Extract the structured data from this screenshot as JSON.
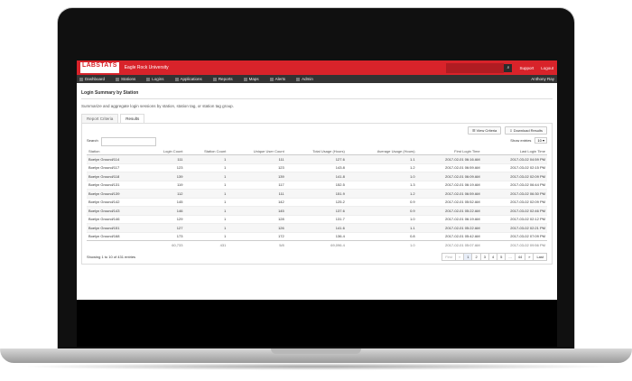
{
  "app": {
    "logo": "LABSTATS",
    "org": "Eagle Rock University",
    "top_links": [
      "Support",
      "Logout"
    ],
    "nav": [
      {
        "label": "Dashboard",
        "icon": "home-icon"
      },
      {
        "label": "Stations",
        "icon": "monitor-icon"
      },
      {
        "label": "Logins",
        "icon": "user-icon"
      },
      {
        "label": "Applications",
        "icon": "app-icon"
      },
      {
        "label": "Reports",
        "icon": "chart-icon"
      },
      {
        "label": "Maps",
        "icon": "map-icon"
      },
      {
        "label": "Alerts",
        "icon": "bell-icon"
      },
      {
        "label": "Admin",
        "icon": "gear-icon"
      }
    ],
    "user": "Anthony Ray"
  },
  "report": {
    "title": "Login Summary by Station",
    "description": "Summarize and aggregate login sessions by station, station tag, or station tag group.",
    "tabs": [
      "Report Criteria",
      "Results"
    ],
    "view_criteria": "View Criteria",
    "download": "Download Results",
    "search_label": "Search",
    "show_entries_label": "Show entries",
    "show_entries_value": "10",
    "columns": [
      "Station",
      "Login Count",
      "Station Count",
      "Unique User Count",
      "Total Usage (Hours)",
      "Average Usage (Hours)",
      "First Login Time",
      "Last Login Time"
    ],
    "rows": [
      [
        "Boelyn Ground/114",
        "111",
        "1",
        "111",
        "127.6",
        "1.1",
        "2017-02-01 06:16 AM",
        "2017-03-02 04:59 PM"
      ],
      [
        "Boelyn Ground/117",
        "123",
        "1",
        "123",
        "143.8",
        "1.2",
        "2017-02-01 06:59 AM",
        "2017-03-02 02:15 PM"
      ],
      [
        "Boelyn Ground/118",
        "139",
        "1",
        "139",
        "141.8",
        "1.0",
        "2017-02-01 06:09 AM",
        "2017-03-02 02:09 PM"
      ],
      [
        "Boelyn Ground/131",
        "119",
        "1",
        "117",
        "152.5",
        "1.3",
        "2017-02-01 06:19 AM",
        "2017-03-02 06:44 PM"
      ],
      [
        "Boelyn Ground/139",
        "112",
        "1",
        "111",
        "151.9",
        "1.2",
        "2017-02-01 06:59 AM",
        "2017-03-02 06:30 PM"
      ],
      [
        "Boelyn Ground/142",
        "145",
        "1",
        "142",
        "125.2",
        "0.9",
        "2017-02-01 05:52 AM",
        "2017-03-02 02:09 PM"
      ],
      [
        "Boelyn Ground/143",
        "146",
        "1",
        "145",
        "137.6",
        "0.9",
        "2017-02-01 05:22 AM",
        "2017-03-02 02:46 PM"
      ],
      [
        "Boelyn Ground/146",
        "129",
        "1",
        "128",
        "131.7",
        "1.0",
        "2017-02-01 06:19 AM",
        "2017-03-02 02:12 PM"
      ],
      [
        "Boelyn Ground/151",
        "127",
        "1",
        "126",
        "141.6",
        "1.1",
        "2017-02-01 05:22 AM",
        "2017-03-02 02:21 PM"
      ],
      [
        "Boelyn Ground/168",
        "173",
        "1",
        "172",
        "136.4",
        "0.8",
        "2017-02-01 05:42 AM",
        "2017-03-02 07:09 PM"
      ]
    ],
    "total": [
      "",
      "60,733",
      "431",
      "5/8",
      "69,096.4",
      "1.0",
      "2017-02-01 05:07 AM",
      "2017-03-02 09:56 PM"
    ],
    "showing": "Showing 1 to 10 of 431 entries",
    "pager": [
      "First",
      "«",
      "1",
      "2",
      "3",
      "4",
      "5",
      "...",
      "44",
      "»",
      "Last"
    ]
  }
}
